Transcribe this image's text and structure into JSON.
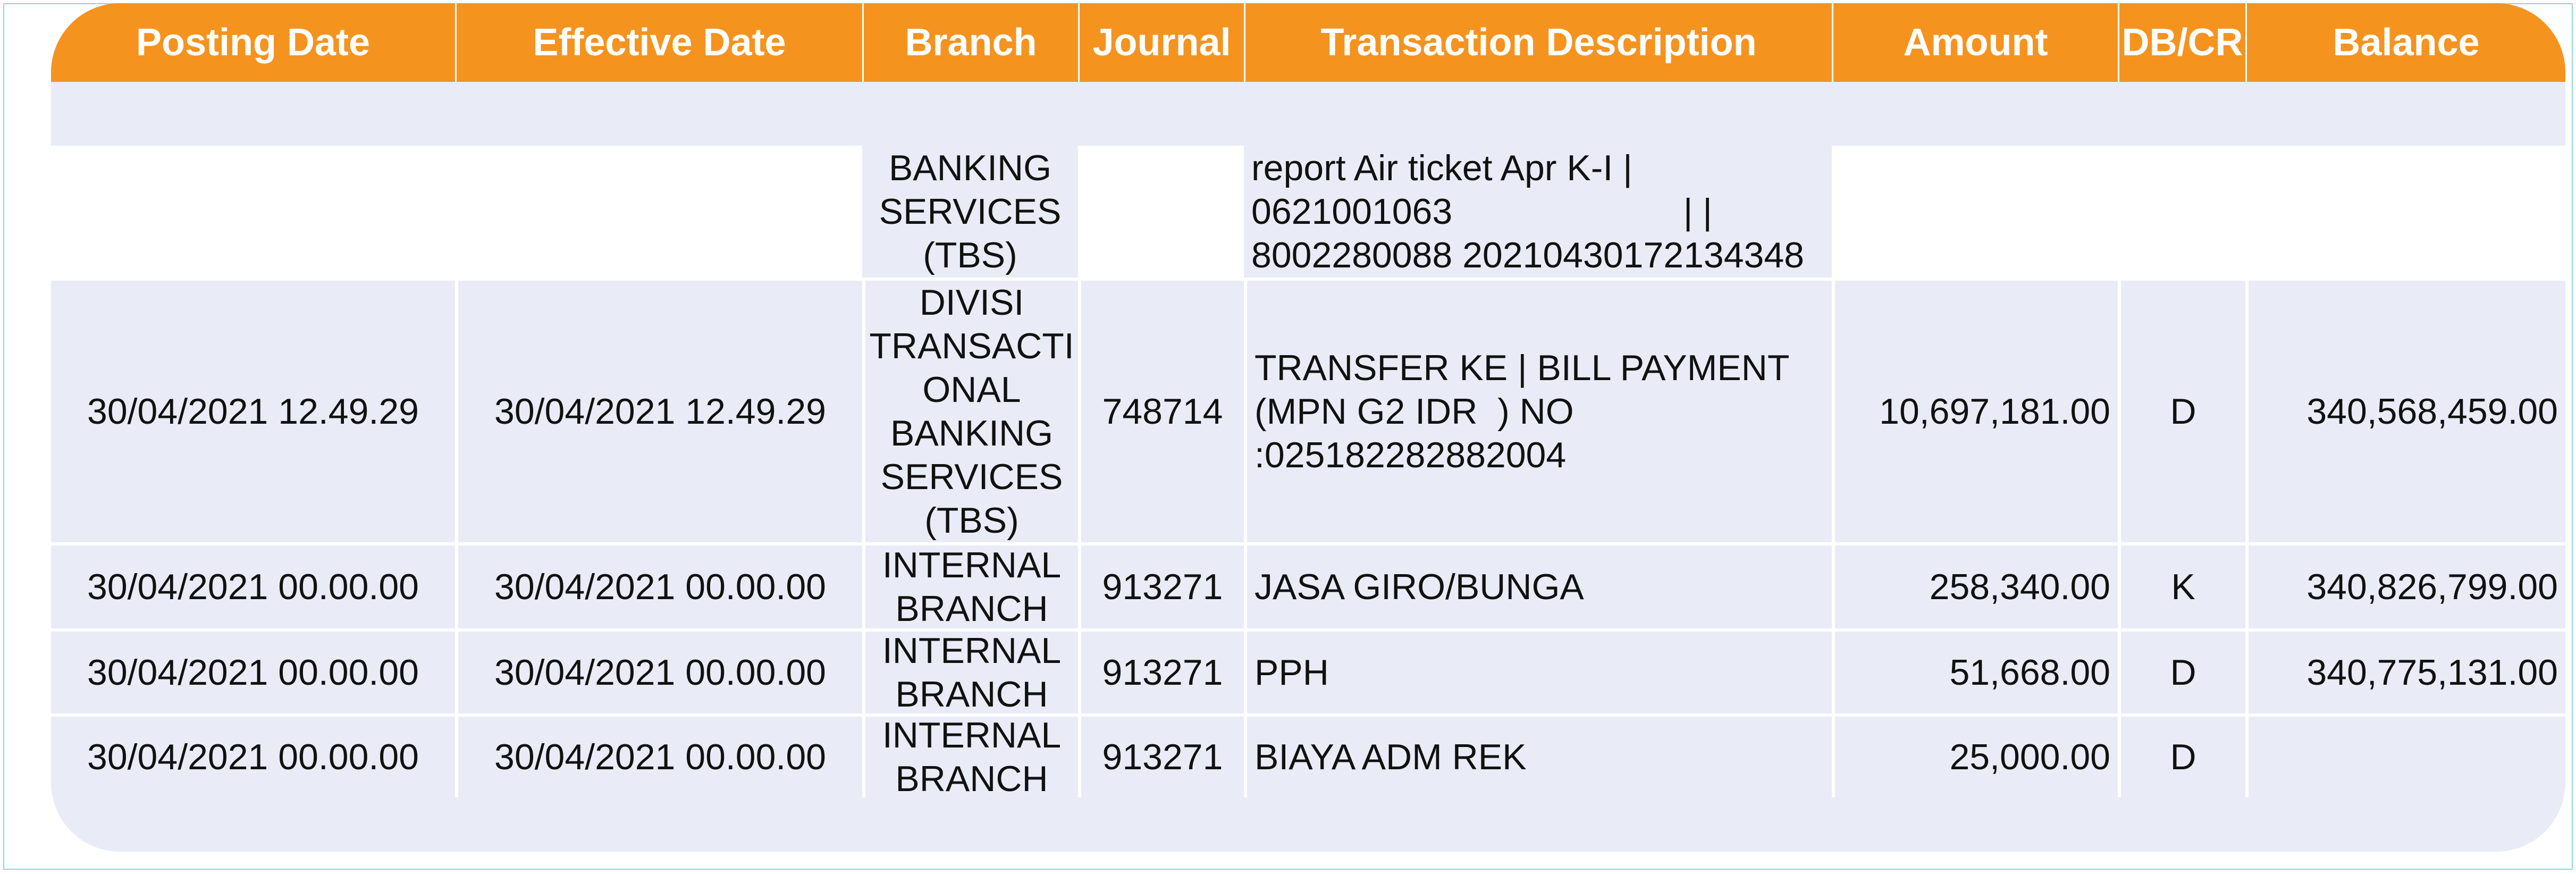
{
  "headers": {
    "posting_date": "Posting Date",
    "effective_date": "Effective Date",
    "branch": "Branch",
    "journal": "Journal",
    "description": "Transaction Description",
    "amount": "Amount",
    "dbcr": "DB/CR",
    "balance": "Balance"
  },
  "partial_row": {
    "branch": [
      "BANKING",
      "SERVICES",
      "(TBS)"
    ],
    "description": [
      "report Air ticket Apr K-I |",
      "0621001063                       | |",
      "8002280088 20210430172134348"
    ]
  },
  "rows": [
    {
      "posting_date": "30/04/2021 12.49.29",
      "effective_date": "30/04/2021 12.49.29",
      "branch": [
        "DIVISI",
        "TRANSACTI",
        "ONAL",
        "BANKING",
        "SERVICES",
        "(TBS)"
      ],
      "journal": "748714",
      "description": [
        "TRANSFER KE | BILL PAYMENT",
        "(MPN G2 IDR  ) NO",
        ":025182282882004"
      ],
      "amount": "10,697,181.00",
      "dbcr": "D",
      "balance": "340,568,459.00"
    },
    {
      "posting_date": "30/04/2021 00.00.00",
      "effective_date": "30/04/2021 00.00.00",
      "branch": [
        "INTERNAL",
        "BRANCH"
      ],
      "journal": "913271",
      "description": [
        "JASA GIRO/BUNGA"
      ],
      "amount": "258,340.00",
      "dbcr": "K",
      "balance": "340,826,799.00"
    },
    {
      "posting_date": "30/04/2021 00.00.00",
      "effective_date": "30/04/2021 00.00.00",
      "branch": [
        "INTERNAL",
        "BRANCH"
      ],
      "journal": "913271",
      "description": [
        "PPH"
      ],
      "amount": "51,668.00",
      "dbcr": "D",
      "balance": "340,775,131.00"
    },
    {
      "posting_date": "30/04/2021 00.00.00",
      "effective_date": "30/04/2021 00.00.00",
      "branch": [
        "INTERNAL",
        "BRANCH"
      ],
      "journal": "913271",
      "description": [
        "BIAYA ADM REK"
      ],
      "amount": "25,000.00",
      "dbcr": "D",
      "balance": ""
    }
  ],
  "colors": {
    "header_bg": "#f5931f",
    "row_bg": "#e9ecf6",
    "text": "#111111"
  }
}
